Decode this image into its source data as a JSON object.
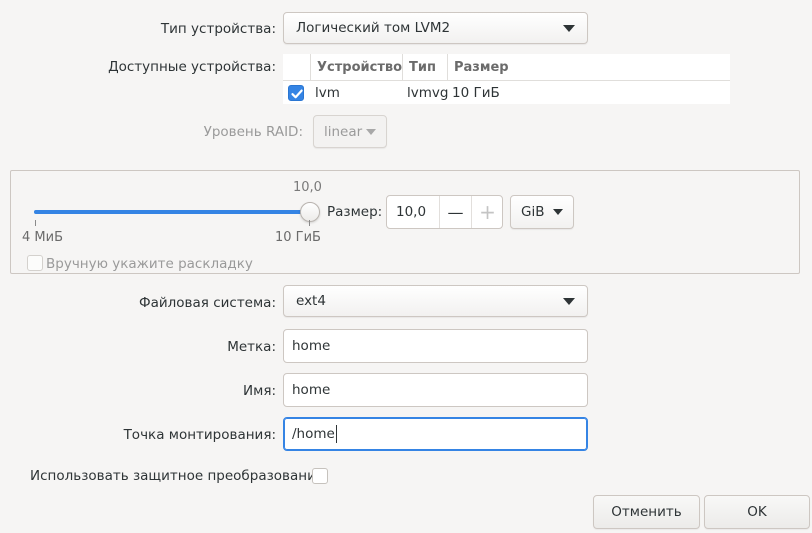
{
  "device_type": {
    "label": "Тип устройства:",
    "value": "Логический том LVM2"
  },
  "available_devices": {
    "label": "Доступные устройства:",
    "columns": [
      "Устройство",
      "Тип",
      "Размер"
    ],
    "rows": [
      {
        "checked": true,
        "device": "lvm",
        "type": "lvmvg",
        "size": "10 ГиБ"
      }
    ]
  },
  "raid_level": {
    "label": "Уровень RAID:",
    "value": "linear"
  },
  "size": {
    "current_label": "10,0",
    "min_label": "4 МиБ",
    "max_label": "10 ГиБ",
    "fraction": 1.0,
    "size_label": "Размер:",
    "value": "10,0",
    "unit": "GiB",
    "minus_glyph": "—",
    "plus_glyph": "+",
    "manual_layout_label": "Вручную укажите раскладку",
    "manual_layout_checked": false
  },
  "filesystem": {
    "label": "Файловая система:",
    "value": "ext4"
  },
  "label_field": {
    "label": "Метка:",
    "value": "home"
  },
  "name_field": {
    "label": "Имя:",
    "value": "home"
  },
  "mountpoint": {
    "label": "Точка монтирования:",
    "value": "/home"
  },
  "encryption": {
    "label": "Использовать защитное преобразование:",
    "checked": false
  },
  "buttons": {
    "cancel": "Отменить",
    "ok": "OK"
  },
  "colors": {
    "accent": "#3584e4",
    "background": "#f6f5f4"
  }
}
